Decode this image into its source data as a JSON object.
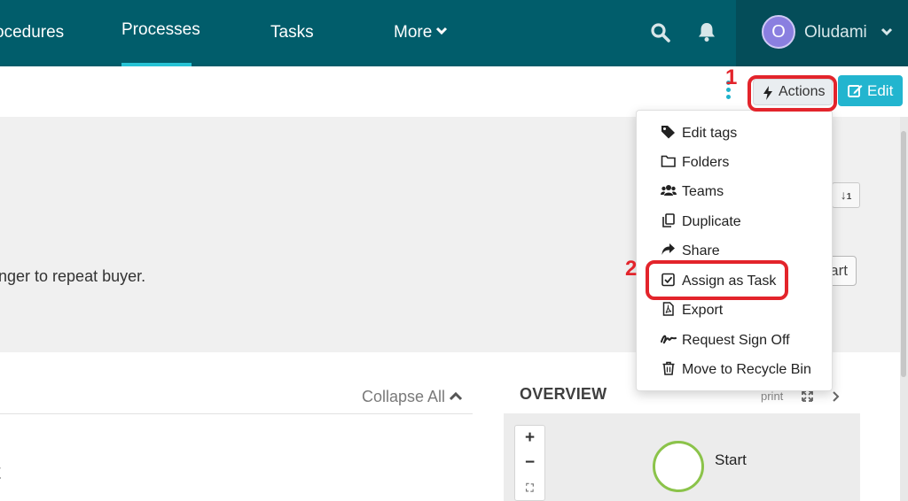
{
  "nav": {
    "items": [
      {
        "label": "ocedures"
      },
      {
        "label": "Processes",
        "active": true
      },
      {
        "label": "Tasks"
      },
      {
        "label": "More"
      }
    ],
    "user": {
      "initial": "O",
      "name": "Oludami"
    },
    "colors": {
      "nav_bg": "#015d6b",
      "active_underline": "#27c4d6",
      "avatar": "#8a7fe0"
    }
  },
  "toolbar": {
    "actions_label": "Actions",
    "edit_label": "Edit",
    "colors": {
      "edit_bg": "#22b5cf",
      "kebab": "#1eb2cc"
    }
  },
  "panel": {
    "description": "nger to repeat buyer.",
    "sort_icon": "sort-numeric-icon",
    "start_label": "art"
  },
  "dropdown": {
    "items": [
      {
        "label": "Edit tags",
        "icon": "tag-icon"
      },
      {
        "label": "Folders",
        "icon": "folder-icon"
      },
      {
        "label": "Teams",
        "icon": "users-icon"
      },
      {
        "label": "Duplicate",
        "icon": "copy-icon"
      },
      {
        "label": "Share",
        "icon": "share-icon"
      },
      {
        "label": "Assign as Task",
        "icon": "check-square-icon"
      },
      {
        "label": "Export",
        "icon": "pdf-file-icon"
      },
      {
        "label": "Request Sign Off",
        "icon": "signature-icon"
      },
      {
        "label": "Move to Recycle Bin",
        "icon": "trash-icon"
      }
    ]
  },
  "content": {
    "collapse_all": "Collapse All",
    "partial_text": "t"
  },
  "overview": {
    "title": "OVERVIEW",
    "print": "print",
    "zoom_in": "+",
    "zoom_out": "−",
    "start_node": "Start"
  },
  "annotations": {
    "step1": "1",
    "step2": "2",
    "color": "#e3242b"
  }
}
